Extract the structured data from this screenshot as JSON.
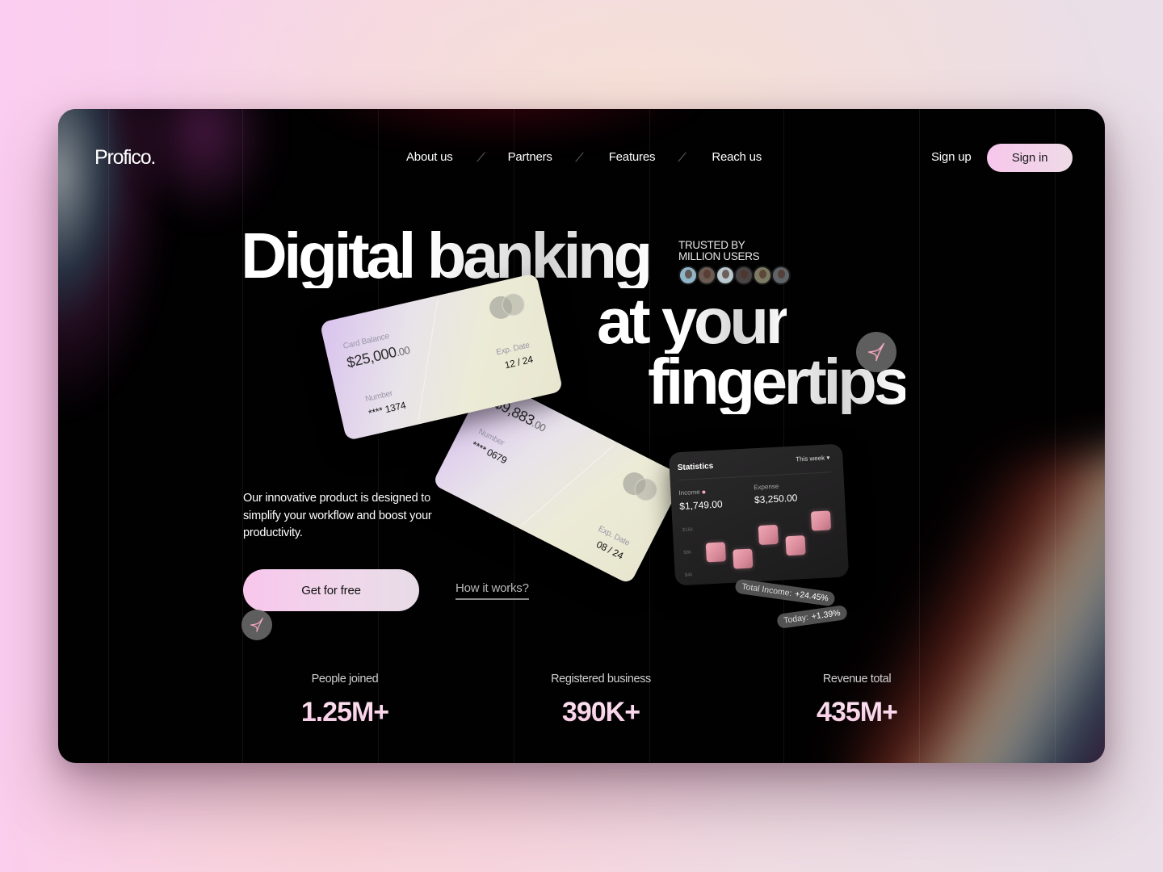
{
  "brand": {
    "logo": "Profico."
  },
  "nav": {
    "items": [
      {
        "label": "About us"
      },
      {
        "label": "Partners"
      },
      {
        "label": "Features"
      },
      {
        "label": "Reach us"
      }
    ],
    "signup_label": "Sign up",
    "signin_label": "Sign in"
  },
  "hero": {
    "line1": "Digital banking",
    "line2": "at your",
    "line3": "fingertips",
    "trusted_line1": "TRUSTED BY",
    "trusted_line2": "MILLION USERS",
    "avatar_colors": [
      "#8fb5c8",
      "#6b5a52",
      "#b9c9cf",
      "#4a4545",
      "#7c7a62",
      "#5f6468"
    ],
    "description": "Our innovative product is designed to simplify your workflow and boost your productivity.",
    "cta_label": "Get for free",
    "secondary_label": "How it works?"
  },
  "cards": [
    {
      "balance_label": "Card Balance",
      "balance_main": "$25,000",
      "balance_cents": ".00",
      "number_label": "Number",
      "number": "**** 1374",
      "exp_label": "Exp. Date",
      "exp": "12 / 24"
    },
    {
      "balance_main": "$9,883",
      "balance_cents": ".00",
      "number_label": "Number",
      "number": "**** 0679",
      "exp_label": "Exp. Date",
      "exp": "08 / 24"
    }
  ],
  "statistics": {
    "title": "Statistics",
    "period": "This week",
    "income_label": "Income",
    "income_value": "$1,749.00",
    "expense_label": "Expense",
    "expense_value": "$3,250.00",
    "y_ticks": [
      "$16k",
      "$8k",
      "$4k"
    ],
    "bars": [
      0.35,
      0.2,
      0.6,
      0.38,
      0.8
    ],
    "total_income_label": "Total Income:",
    "total_income_value": "+24.45%",
    "today_label": "Today:",
    "today_value": "+1.39%"
  },
  "metrics": [
    {
      "label": "People joined",
      "value": "1.25M+"
    },
    {
      "label": "Registered business",
      "value": "390K+"
    },
    {
      "label": "Revenue total",
      "value": "435M+"
    }
  ],
  "icons": {
    "sparkle": "sparkle-icon",
    "dropdown": "caret-down-icon",
    "card_brand": "card-network-icon"
  }
}
